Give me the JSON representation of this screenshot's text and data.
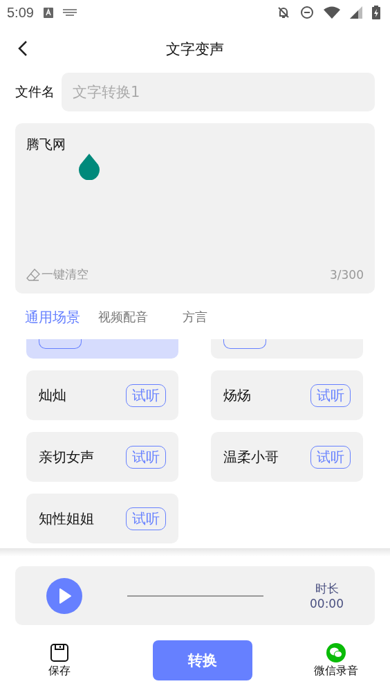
{
  "status_bar": {
    "time": "5:09"
  },
  "header": {
    "title": "文字变声"
  },
  "file_name": {
    "label": "文件名",
    "placeholder": "文字转换1"
  },
  "editor": {
    "value": "腾飞网",
    "clear_label": "一键清空",
    "count": "3/300"
  },
  "tabs": [
    {
      "label": "通用场景",
      "selected": true
    },
    {
      "label": "视频配音",
      "selected": false
    },
    {
      "label": "方言",
      "selected": false
    }
  ],
  "voices": [
    {
      "kind": "cut",
      "selected": true
    },
    {
      "kind": "cut",
      "selected": false
    },
    {
      "kind": "full",
      "name": "灿灿",
      "button": "试听",
      "selected": false
    },
    {
      "kind": "full",
      "name": "炀炀",
      "button": "试听",
      "selected": false
    },
    {
      "kind": "full",
      "name": "亲切女声",
      "button": "试听",
      "selected": false
    },
    {
      "kind": "full",
      "name": "温柔小哥",
      "button": "试听",
      "selected": false
    },
    {
      "kind": "full",
      "name": "知性姐姐",
      "button": "试听",
      "selected": false
    }
  ],
  "player": {
    "duration_label": "时长",
    "duration": "00:00"
  },
  "bottom_bar": {
    "save": "保存",
    "convert": "转换",
    "wechat": "微信录音"
  }
}
